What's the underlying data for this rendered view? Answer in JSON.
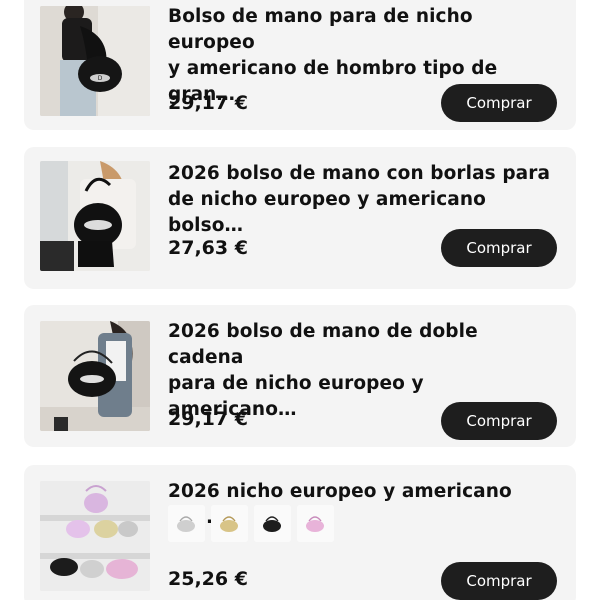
{
  "products": [
    {
      "title": "Bolso de mano para de nicho europeo\ny americano de hombro tipo de gran…",
      "price": "29,17 €",
      "buy_label": "Comprar",
      "image": "woman-with-black-shoulder-bag"
    },
    {
      "title": "2026 bolso de mano con borlas para\nde nicho europeo y americano bolso…",
      "price": "27,63 €",
      "buy_label": "Comprar",
      "image": "woman-with-black-leather-bag"
    },
    {
      "title": "2026 bolso de mano de doble cadena\npara de nicho europeo y americano…",
      "price": "29,17 €",
      "buy_label": "Comprar",
      "image": "woman-with-chain-bag"
    },
    {
      "title": "2026 nicho europeo y americano bo…",
      "price": "25,26 €",
      "buy_label": "Comprar",
      "image": "metallic-mini-bags-display",
      "variants": [
        "silver-bag",
        "gold-bag",
        "black-bag",
        "pink-bag"
      ]
    }
  ]
}
